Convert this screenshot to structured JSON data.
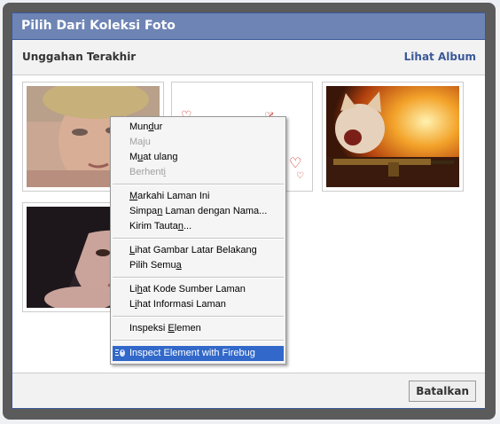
{
  "dialog": {
    "title": "Pilih Dari Koleksi Foto",
    "section_title": "Unggahan Terakhir",
    "album_link": "Lihat Album",
    "cancel_button": "Batalkan"
  },
  "context_menu": {
    "items": [
      {
        "pre": "Mun",
        "ul": "d",
        "post": "ur",
        "disabled": false
      },
      {
        "pre": "Ma",
        "ul": "j",
        "post": "u",
        "disabled": true
      },
      {
        "pre": "M",
        "ul": "u",
        "post": "at ulang",
        "disabled": false
      },
      {
        "pre": "Berhent",
        "ul": "i",
        "post": "",
        "disabled": true
      },
      {
        "pre": "",
        "ul": "M",
        "post": "arkahi Laman Ini",
        "disabled": false
      },
      {
        "pre": "Simpa",
        "ul": "n",
        "post": " Laman dengan Nama...",
        "disabled": false
      },
      {
        "pre": "Kirim Tauta",
        "ul": "n",
        "post": "...",
        "disabled": false
      },
      {
        "pre": "",
        "ul": "L",
        "post": "ihat Gambar Latar Belakang",
        "disabled": false
      },
      {
        "pre": "Pilih Semu",
        "ul": "a",
        "post": "",
        "disabled": false
      },
      {
        "pre": "Li",
        "ul": "h",
        "post": "at Kode Sumber Laman",
        "disabled": false
      },
      {
        "pre": "L",
        "ul": "i",
        "post": "hat Informasi Laman",
        "disabled": false
      },
      {
        "pre": "Inspeksi ",
        "ul": "E",
        "post": "lemen",
        "disabled": false
      }
    ],
    "highlighted_item": "Inspect Element with Firebug",
    "highlight_color": "#3168c9"
  },
  "colors": {
    "header_bg": "#6d84b4",
    "link": "#3b5998"
  },
  "icons": {
    "firebug": "firebug-icon"
  }
}
